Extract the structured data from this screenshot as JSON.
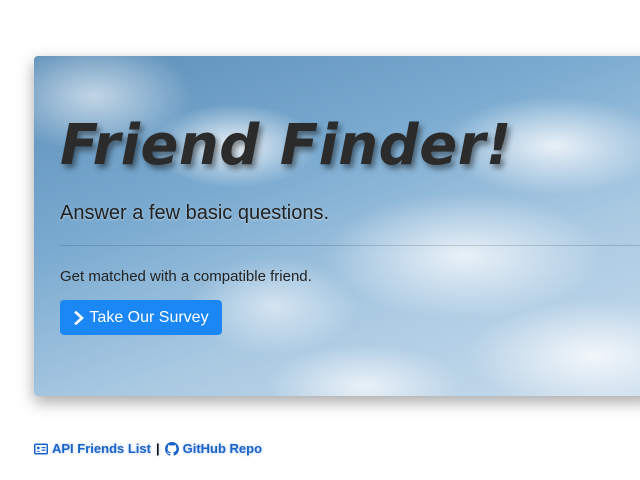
{
  "jumbotron": {
    "title": "Friend Finder!",
    "lead": "Answer a few basic questions.",
    "subtext": "Get matched with a compatible friend.",
    "survey_button": {
      "label": "Take Our Survey",
      "icon": "chevron-right-icon"
    }
  },
  "footer": {
    "links": [
      {
        "label": "API Friends List",
        "icon": "id-card-icon"
      },
      {
        "label": "GitHub Repo",
        "icon": "github-icon"
      }
    ],
    "separator": "|"
  },
  "colors": {
    "button_bg": "#1a87f5",
    "link": "#1a63c9",
    "title": "#2b2b2b"
  }
}
